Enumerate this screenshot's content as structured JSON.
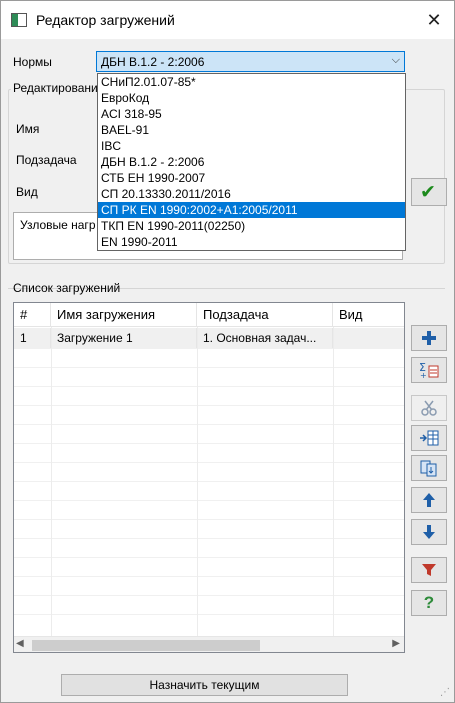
{
  "window": {
    "title": "Редактор загружений",
    "close_glyph": "✕"
  },
  "norms": {
    "label": "Нормы",
    "selected": "ДБН В.1.2 - 2:2006",
    "options": [
      "СНиП2.01.07-85*",
      "ЕвроКод",
      "ACI 318-95",
      "BAEL-91",
      "IBC",
      "ДБН В.1.2 - 2:2006",
      "СТБ ЕН 1990-2007",
      "СП 20.13330.2011/2016",
      "СП РК EN 1990:2002+A1:2005/2011",
      "ТКП EN 1990-2011(02250)",
      "EN 1990-2011"
    ],
    "highlighted_option": "СП РК EN 1990:2002+A1:2005/2011"
  },
  "edit_group": {
    "title": "Редактирование",
    "name_label": "Имя",
    "subtask_label": "Подзадача",
    "kind_label": "Вид",
    "nodal_text": "Узловые нагр"
  },
  "list_group": {
    "title": "Список загружений",
    "columns": [
      "#",
      "Имя загружения",
      "Подзадача",
      "Вид"
    ],
    "rows": [
      {
        "num": "1",
        "name": "Загружение 1",
        "subtask": "1. Основная задач...",
        "kind": ""
      }
    ]
  },
  "toolbar": {
    "add": "add-icon",
    "sum": "sum-icon",
    "cut": "scissors-icon",
    "insert": "insert-rows-icon",
    "copy": "copy-icon",
    "up": "arrow-up-icon",
    "down": "arrow-down-icon",
    "filter": "filter-icon",
    "help": "help-icon"
  },
  "colors": {
    "accent": "#0078d7",
    "apply_check": "#1d8a1d",
    "tool_blue": "#1f5fa8",
    "filter_red": "#c0392b",
    "help_green": "#2e8b3a"
  },
  "footer": {
    "assign_button": "Назначить текущим"
  }
}
